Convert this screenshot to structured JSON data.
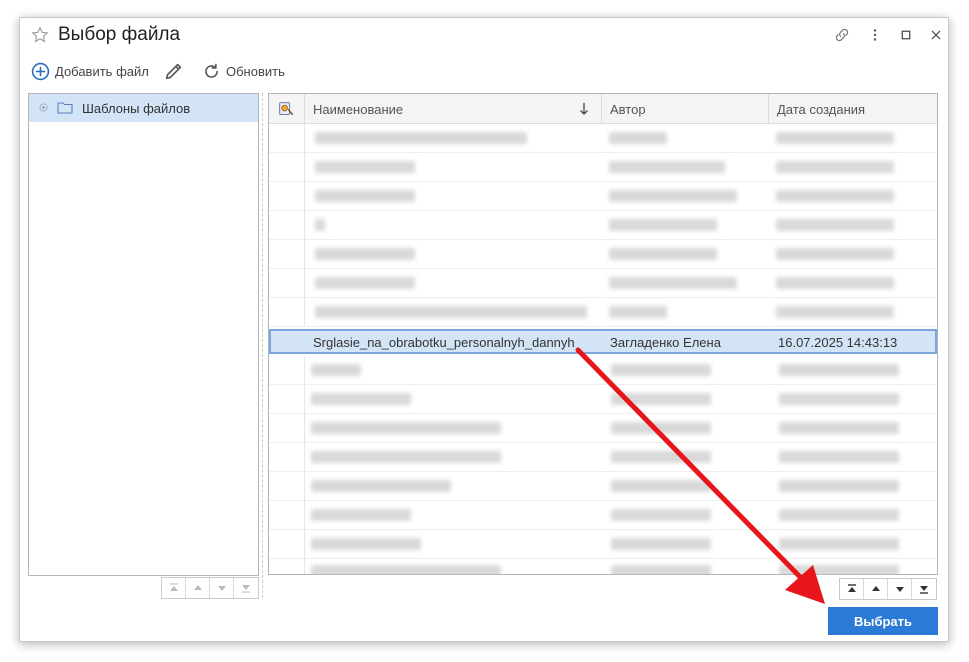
{
  "window": {
    "title": "Выбор файла",
    "controls": [
      "link-icon",
      "more-icon",
      "maximize-icon",
      "close-icon"
    ]
  },
  "toolbar": {
    "add_label": "Добавить файл",
    "refresh_label": "Обновить"
  },
  "tree": {
    "items": [
      {
        "label": "Шаблоны файлов"
      }
    ]
  },
  "grid": {
    "columns": [
      "Наименование",
      "Автор",
      "Дата создания"
    ],
    "selected_row": {
      "name": "Srglasie_na_obrabotku_personalnyh_dannyh",
      "author": "Загладенко Елена",
      "created": "16.07.2025 14:43:13"
    }
  },
  "footer": {
    "select_label": "Выбрать"
  },
  "colors": {
    "accent": "#2b7ad6",
    "selection": "#d3e4f6",
    "annotation_arrow": "#e8161b"
  }
}
